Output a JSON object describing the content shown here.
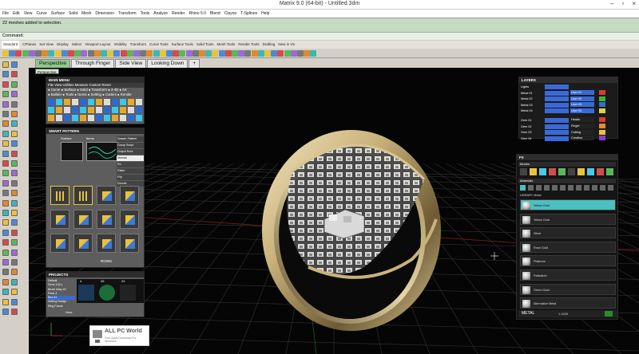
{
  "window": {
    "title": "Matrix 9.0 (64-bit) - Untitled.3dm",
    "controls": [
      "–",
      "▫",
      "×"
    ]
  },
  "menubar": [
    "File",
    "Edit",
    "View",
    "Curve",
    "Surface",
    "Solid",
    "Mesh",
    "Dimension",
    "Transform",
    "Tools",
    "Analyze",
    "Render",
    "Rhino 5.0",
    "Blend",
    "Clayoo",
    "T-Splines",
    "Help"
  ],
  "command_history": "22 meshes added to selection.",
  "command_prompt": "Command:",
  "toolbar_tabs": [
    "Standard",
    "CPlanes",
    "Set View",
    "Display",
    "Select",
    "Viewport Layout",
    "Visibility",
    "Transform",
    "Curve Tools",
    "Surface Tools",
    "Solid Tools",
    "Mesh Tools",
    "Render Tools",
    "Drafting",
    "New in V5"
  ],
  "viewport_tabs": [
    "Perspective",
    "Through Finger",
    "Side View",
    "Looking Down",
    "+"
  ],
  "viewport_label": "Perspective",
  "main_menu": {
    "title": "MAIN MENU",
    "rows": [
      "File  View  Utilities  Measure  Custom          Reset",
      "● Curve ● Surface ● Solid ● Transform ● 3-4D ● Art",
      "● Builder ● Tools ● Gems ● Setting ● Cutters ● Render"
    ]
  },
  "smart_pattern": {
    "title": "SMART PATTERN",
    "col1": "Surface",
    "col2": "Items",
    "options": [
      "Drawer Pattern",
      "Group Script",
      "Output Root",
      "Normal",
      "Ro",
      "Raise",
      "Flip",
      "Donuts"
    ],
    "rows_label": "ROWS"
  },
  "projects": {
    "title": "PROJECTS",
    "items": [
      "Default",
      "Gens 10(+)",
      "Bezel Inlay 42",
      "Petal 4",
      "Bez #1",
      "Setting Design",
      "Ring Frame"
    ],
    "counts": [
      "4",
      "25",
      "24"
    ],
    "hour_label": "Hour"
  },
  "layers": {
    "title": "LAYERS",
    "left": [
      "Lights",
      "Metal 01",
      "Metal 02",
      "Metal 03",
      "Metal 04",
      "Gem 01",
      "Gem 02",
      "Gem 03",
      "Gem 04"
    ],
    "right": [
      "User 01",
      "User 02",
      "User 03",
      "User 04",
      "Heads",
      "Finger",
      "Cutting",
      "Creation"
    ]
  },
  "fx": {
    "title": "FX",
    "modes_label": "Modes",
    "materials_label": "Materials",
    "library": "LIBRARY Metal",
    "materials": [
      "Yellow Gold",
      "Yellow Gold",
      "Silver",
      "Rose Gold",
      "Platinum",
      "Palladium",
      "Green Gold",
      "Alternative Metal"
    ],
    "footer": "METAL",
    "footer_val": "1.4435"
  },
  "watermark": {
    "name": "ALL PC World",
    "sub": "Free Apps Download For Windows"
  },
  "colors": {
    "viewport_bg": "#050505",
    "grid": "#3a3a3a",
    "active_tab": "#8fc68f",
    "command_area": "#c7dac4",
    "selected_material": "#4cbfbf",
    "gold": "#c9b27a"
  }
}
